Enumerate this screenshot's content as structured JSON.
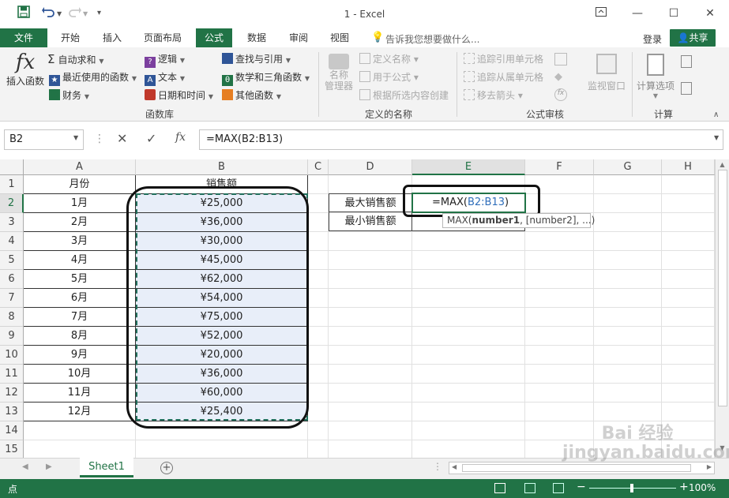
{
  "window": {
    "title": "1 - Excel"
  },
  "tabs": [
    "文件",
    "开始",
    "插入",
    "页面布局",
    "公式",
    "数据",
    "审阅",
    "视图"
  ],
  "tell_me": "告诉我您想要做什么...",
  "account": {
    "login": "登录",
    "share": "共享"
  },
  "ribbon": {
    "insert_function": "插入函数",
    "autosum": "自动求和",
    "recent": "最近使用的函数",
    "financial": "财务",
    "logical": "逻辑",
    "text": "文本",
    "datetime": "日期和时间",
    "lookup": "查找与引用",
    "math": "数学和三角函数",
    "other": "其他函数",
    "group_library": "函数库",
    "name_manager": "名称\n管理器",
    "define_name": "定义名称",
    "use_in_formula": "用于公式",
    "create_from_selection": "根据所选内容创建",
    "group_names": "定义的名称",
    "trace_precedents": "追踪引用单元格",
    "trace_dependents": "追踪从属单元格",
    "remove_arrows": "移去箭头",
    "watch_window": "监视窗口",
    "group_audit": "公式审核",
    "calc_options": "计算选项",
    "group_calc": "计算"
  },
  "formula_bar": {
    "name_box": "B2",
    "formula": "=MAX(B2:B13)"
  },
  "columns": [
    "A",
    "B",
    "C",
    "D",
    "E",
    "F",
    "G",
    "H"
  ],
  "rows": [
    "1",
    "2",
    "3",
    "4",
    "5",
    "6",
    "7",
    "8",
    "9",
    "10",
    "11",
    "12",
    "13",
    "14",
    "15"
  ],
  "sheet": {
    "header_month": "月份",
    "header_sales": "销售额",
    "months": [
      "1月",
      "2月",
      "3月",
      "4月",
      "5月",
      "6月",
      "7月",
      "8月",
      "9月",
      "10月",
      "11月",
      "12月"
    ],
    "sales": [
      "¥25,000",
      "¥36,000",
      "¥30,000",
      "¥45,000",
      "¥62,000",
      "¥54,000",
      "¥75,000",
      "¥52,000",
      "¥20,000",
      "¥36,000",
      "¥60,000",
      "¥25,400"
    ],
    "max_label": "最大销售额",
    "min_label": "最小销售额",
    "edit_prefix": "=MAX(",
    "edit_ref": "B2:B13",
    "edit_suffix": ")",
    "tooltip_func": "MAX(",
    "tooltip_arg1": "number1",
    "tooltip_rest": ", [number2], ...)"
  },
  "sheet_tab": "Sheet1",
  "status": {
    "mode": "点",
    "zoom": "100%"
  },
  "watermark": "Bai 经验\njingyan.baidu.com"
}
